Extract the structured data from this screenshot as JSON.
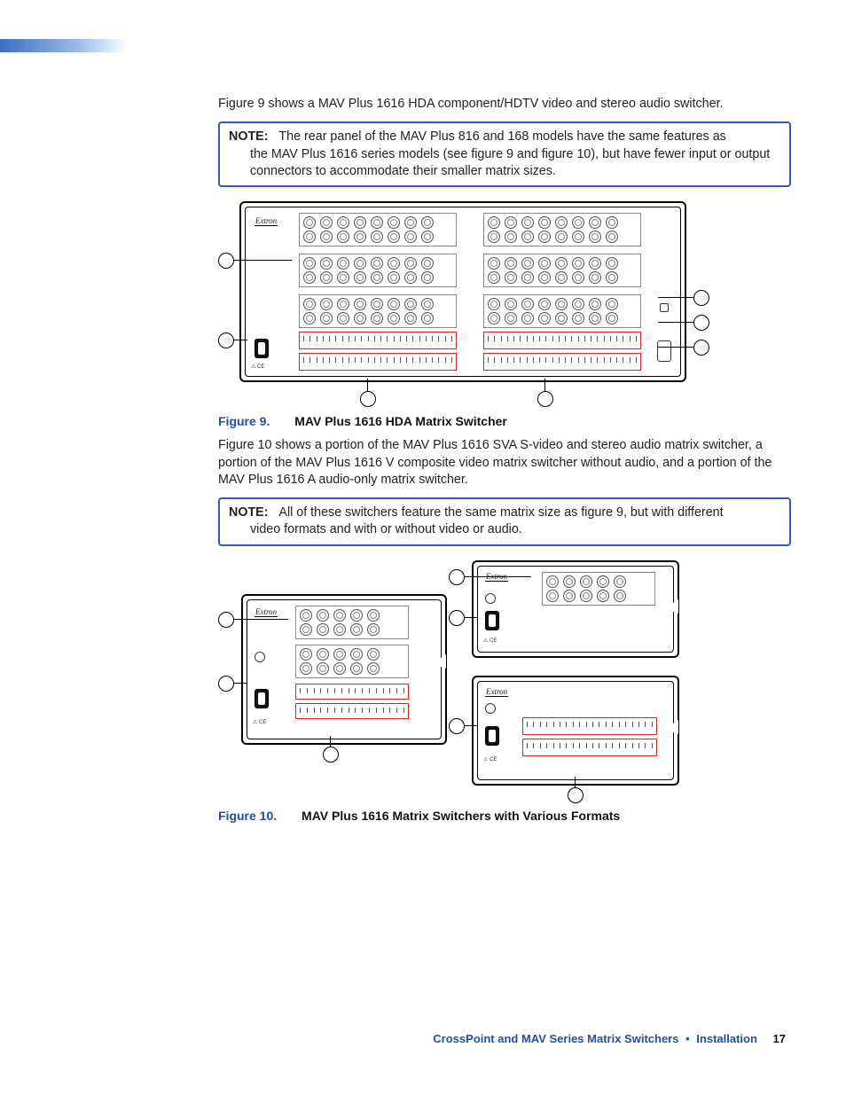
{
  "intro_text": "Figure 9 shows a MAV Plus 1616 HDA component/HDTV video and stereo audio switcher.",
  "note1": {
    "label": "NOTE:",
    "first": "The rear panel of the MAV Plus 816 and 168 models have the same features as",
    "rest": "the MAV Plus 1616 series models (see figure 9 and figure 10), but have fewer input or output connectors to accommodate their smaller matrix sizes."
  },
  "figure9": {
    "number": "Figure 9.",
    "title": "MAV Plus 1616 HDA Matrix Switcher",
    "brand": "Extron"
  },
  "mid_text": "Figure 10 shows a portion of the MAV Plus 1616 SVA S-video and stereo audio matrix switcher, a portion of the MAV Plus 1616 V composite video matrix switcher without audio, and a portion of the MAV Plus 1616 A audio-only matrix switcher.",
  "note2": {
    "label": "NOTE:",
    "first": "All of these switchers feature the same matrix size as figure 9, but with different",
    "rest": "video formats and with or without video or audio."
  },
  "figure10": {
    "number": "Figure 10.",
    "title": "MAV Plus 1616 Matrix Switchers with Various Formats",
    "brand": "Extron"
  },
  "footer": {
    "doc": "CrossPoint and MAV Series Matrix Switchers",
    "section": "Installation",
    "page": "17"
  }
}
